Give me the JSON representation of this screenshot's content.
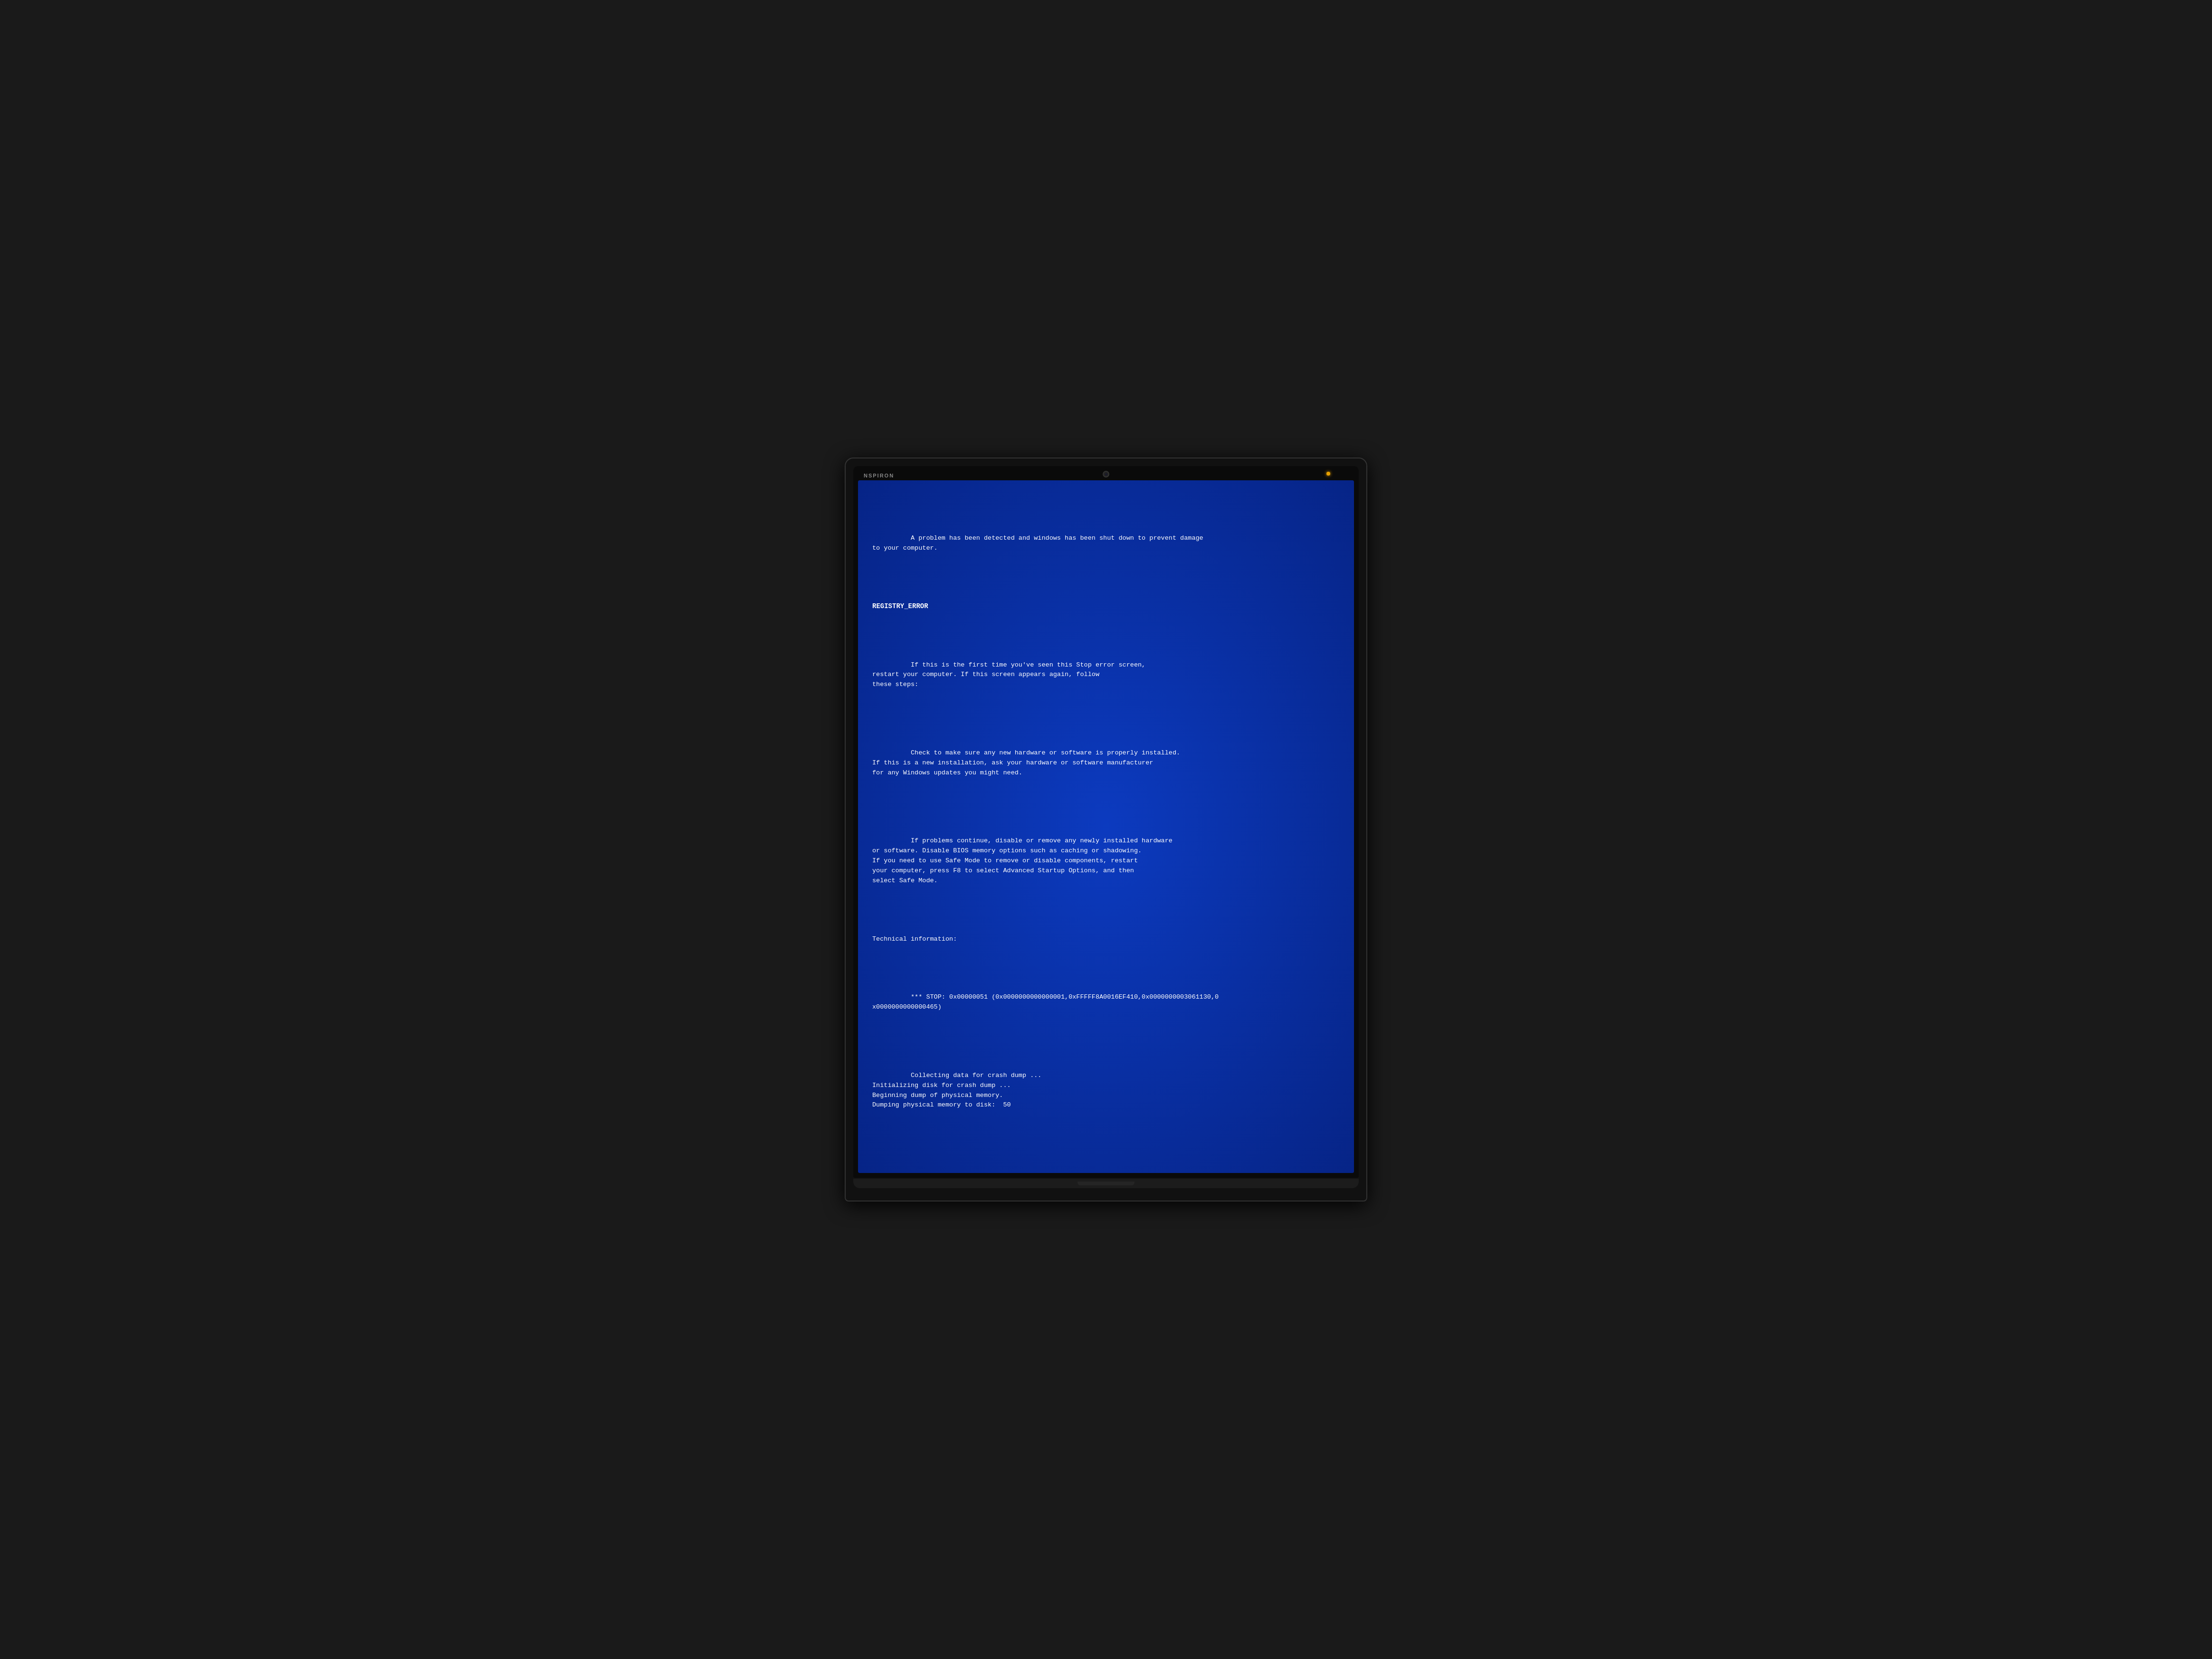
{
  "laptop": {
    "brand": "NSPIRON",
    "indicator_color": "#e8a000"
  },
  "bsod": {
    "line1": "A problem has been detected and windows has been shut down to prevent damage",
    "line2": "to your computer.",
    "error_code": "REGISTRY_ERROR",
    "paragraph1_line1": "If this is the first time you've seen this Stop error screen,",
    "paragraph1_line2": "restart your computer. If this screen appears again, follow",
    "paragraph1_line3": "these steps:",
    "paragraph2_line1": "Check to make sure any new hardware or software is properly installed.",
    "paragraph2_line2": "If this is a new installation, ask your hardware or software manufacturer",
    "paragraph2_line3": "for any Windows updates you might need.",
    "paragraph3_line1": "If problems continue, disable or remove any newly installed hardware",
    "paragraph3_line2": "or software. Disable BIOS memory options such as caching or shadowing.",
    "paragraph3_line3": "If you need to use Safe Mode to remove or disable components, restart",
    "paragraph3_line4": "your computer, press F8 to select Advanced Startup Options, and then",
    "paragraph3_line5": "select Safe Mode.",
    "tech_header": "Technical information:",
    "stop_line1": "*** STOP: 0x00000051 (0x0000000000000001,0xFFFFF8A0016EF410,0x0000000003061130,0",
    "stop_line2": "x0000000000000465)",
    "dump_line1": "Collecting data for crash dump ...",
    "dump_line2": "Initializing disk for crash dump ...",
    "dump_line3": "Beginning dump of physical memory.",
    "dump_line4": "Dumping physical memory to disk:  50"
  }
}
